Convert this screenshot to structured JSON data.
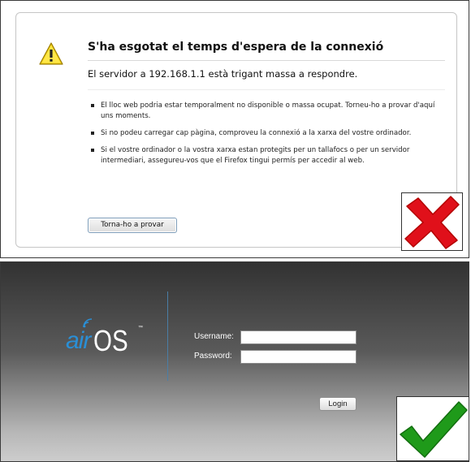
{
  "error_page": {
    "title": "S'ha esgotat el temps d'espera de la connexió",
    "subtitle": "El servidor a 192.168.1.1 està trigant massa a respondre.",
    "bullets": [
      "El lloc web podria estar temporalment no disponible o massa ocupat. Torneu-ho a provar d'aquí uns moments.",
      "Si no podeu carregar cap pàgina, comproveu la connexió a la xarxa del vostre ordinador.",
      "Si el vostre ordinador o la vostra xarxa estan protegits per un tallafocs o per un servidor intermediari, assegureu-vos que el Firefox tingui permís per accedir al web."
    ],
    "retry_label": "Torna-ho a provar",
    "warning_icon": "warning-icon",
    "status_icon": "red-cross-icon",
    "status_color": "#e0101a"
  },
  "login_page": {
    "logo": {
      "air": "air",
      "os": "OS",
      "tm": "™"
    },
    "username_label": "Username:",
    "password_label": "Password:",
    "username_value": "",
    "password_value": "",
    "login_label": "Login",
    "status_icon": "green-check-icon",
    "status_color": "#1f9a1a",
    "brand_color": "#2a8fd6"
  }
}
